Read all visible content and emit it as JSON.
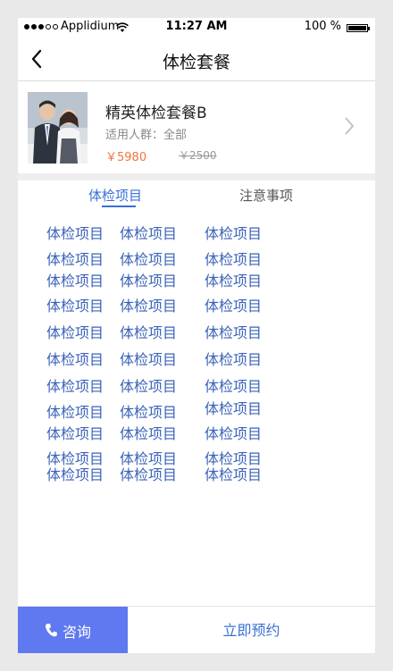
{
  "status_bar": {
    "carrier": "Applidium",
    "time": "11:27 AM",
    "battery": "100 %"
  },
  "nav": {
    "title": "体检套餐"
  },
  "product": {
    "name": "精英体检套餐B",
    "group": "适用人群：全部",
    "price": "￥5980",
    "original_price": "￥2500"
  },
  "tabs": {
    "active": "体检项目",
    "inactive": "注意事项"
  },
  "items": [
    "体检项目",
    "体检项目",
    "体检项目",
    "体检项目",
    "体检项目",
    "体检项目",
    "体检项目",
    "体检项目",
    "体检项目",
    "体检项目",
    "体检项目",
    "体检项目",
    "体检项目",
    "体检项目",
    "体检项目",
    "体检项目",
    "体检项目",
    "体检项目",
    "体检项目",
    "体检项目",
    "体检项目",
    "体检项目",
    "体检项目",
    "体检项目",
    "体检项目",
    "体检项目",
    "体检项目",
    "体检项目",
    "体检项目",
    "体检项目",
    "体检项目",
    "体检项目",
    "体检项目"
  ],
  "bottom": {
    "consult": "咨询",
    "book": "立即预约"
  },
  "colors": {
    "accent": "#3a6fd6",
    "consult_bg": "#5f79f0",
    "price": "#f0763a"
  }
}
